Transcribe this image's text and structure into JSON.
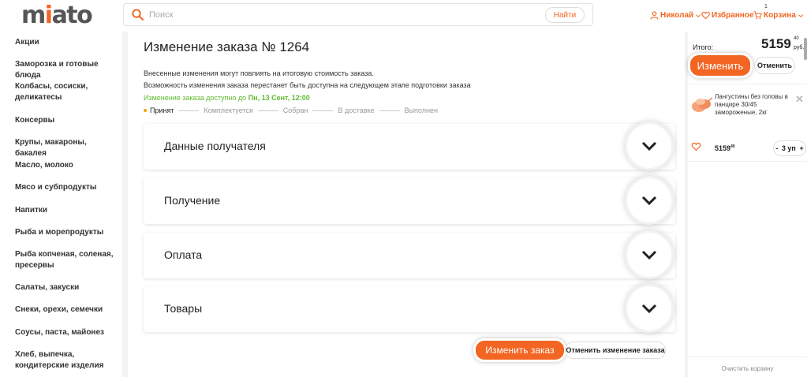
{
  "header": {
    "logo_prefix": "m",
    "logo_accent": "i",
    "logo_suffix": "ato",
    "search_placeholder": "Поиск",
    "search_button": "Найти",
    "user": "Николай",
    "favorites": "Избранное",
    "cart": "Корзина",
    "cart_count": "1"
  },
  "sidebar": {
    "items": [
      "Акции",
      "Заморозка и готовые блюда",
      "Колбасы, сосиски, деликатесы",
      "Консервы",
      "Крупы, макароны, бакалея",
      "Масло, молоко",
      "Мясо и субпродукты",
      "Напитки",
      "Рыба и морепродукты",
      "Рыба копченая, соленая, пресервы",
      "Салаты, закуски",
      "Снеки, орехи, семечки",
      "Соусы, паста, майонез",
      "Хлеб, выпечка, кондитерские изделия"
    ]
  },
  "main": {
    "title": "Изменение заказа № 1264",
    "note1": "Внесенные изменения могут повлиять на итоговую стоимость заказа.",
    "note2": "Возможность изменения заказа перестанет быть доступна на следующем этапе подготовки заказа",
    "available_prefix": "Изменение заказа доступно до",
    "available_date": "Пн, 13 Сент, 12:00",
    "steps": [
      "Принят",
      "Комплектуется",
      "Собран",
      "В доставке",
      "Выполнен"
    ],
    "sections": [
      "Данные получателя",
      "Получение",
      "Оплата",
      "Товары"
    ],
    "change_button": "Изменить заказ",
    "cancel_button": "Отменить изменение заказа"
  },
  "summary": {
    "total_label": "Итого:",
    "total_value": "5159",
    "total_kopeks": "40",
    "currency": "руб.",
    "change_button": "Изменить",
    "cancel_button": "Отменить",
    "product_name": "Лангустины без головы в панцире 30/45 замороженые, 2кг",
    "product_price": "5159",
    "product_kopeks": "40",
    "qty_minus": "-",
    "qty_value": "3 уп",
    "qty_plus": "+",
    "clear_cart": "Очистить корзину"
  },
  "colors": {
    "accent": "#f26522",
    "available": "#5fbb2f",
    "step_dot": "#f2a600"
  }
}
